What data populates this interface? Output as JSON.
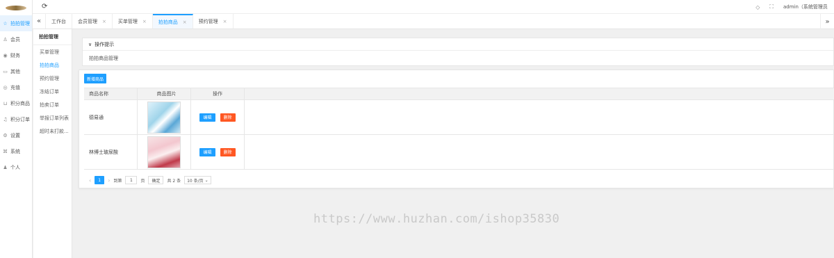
{
  "sidebar": {
    "items": [
      {
        "label": "拍拍管理",
        "icon": "star-icon",
        "glyph": "☆",
        "active": true
      },
      {
        "label": "会员",
        "icon": "user-icon",
        "glyph": "♙",
        "active": false
      },
      {
        "label": "财务",
        "icon": "coin-icon",
        "glyph": "◉",
        "active": false
      },
      {
        "label": "其他",
        "icon": "book-icon",
        "glyph": "▭",
        "active": false
      },
      {
        "label": "充值",
        "icon": "recharge-icon",
        "glyph": "◎",
        "active": false
      },
      {
        "label": "积分商品",
        "icon": "cart-icon",
        "glyph": "⊔",
        "active": false
      },
      {
        "label": "积分订单",
        "icon": "bell-icon",
        "glyph": "♫",
        "active": false
      },
      {
        "label": "设置",
        "icon": "gear-icon",
        "glyph": "⚙",
        "active": false
      },
      {
        "label": "系统",
        "icon": "system-icon",
        "glyph": "⌘",
        "active": false
      },
      {
        "label": "个人",
        "icon": "person-icon",
        "glyph": "♟",
        "active": false
      }
    ]
  },
  "topbar": {
    "admin_label": "admin（系统管理员"
  },
  "tabs": [
    {
      "label": "工作台",
      "closable": false,
      "active": false
    },
    {
      "label": "会员管理",
      "closable": true,
      "active": false
    },
    {
      "label": "买单管理",
      "closable": true,
      "active": false
    },
    {
      "label": "拍拍商品",
      "closable": true,
      "active": true
    },
    {
      "label": "预约管理",
      "closable": true,
      "active": false
    }
  ],
  "submenu": {
    "title": "拍拍管理",
    "items": [
      {
        "label": "买单管理",
        "active": false
      },
      {
        "label": "拍拍商品",
        "active": true
      },
      {
        "label": "预约管理",
        "active": false
      },
      {
        "label": "冻结订单",
        "active": false
      },
      {
        "label": "拍卖订单",
        "active": false
      },
      {
        "label": "举报订单列表",
        "active": false
      },
      {
        "label": "超时未打款...",
        "active": false
      }
    ]
  },
  "tips": {
    "header": "操作提示",
    "body": "拍拍商品管理"
  },
  "toolbar": {
    "add_label": "新增商品"
  },
  "table": {
    "headers": [
      "商品名称",
      "商品图片",
      "操作"
    ],
    "rows": [
      {
        "name": "德易通",
        "edit": "编辑",
        "delete": "删除"
      },
      {
        "name": "林博士玻尿酸",
        "edit": "编辑",
        "delete": "删除"
      }
    ]
  },
  "pagination": {
    "current_page": "1",
    "goto_label": "到第",
    "goto_value": "1",
    "page_unit": "页",
    "confirm": "确定",
    "total": "共 2 条",
    "page_size": "10 条/页"
  },
  "watermark": "https://www.huzhan.com/ishop35830",
  "colors": {
    "accent": "#1e9fff",
    "danger": "#ff5722"
  }
}
